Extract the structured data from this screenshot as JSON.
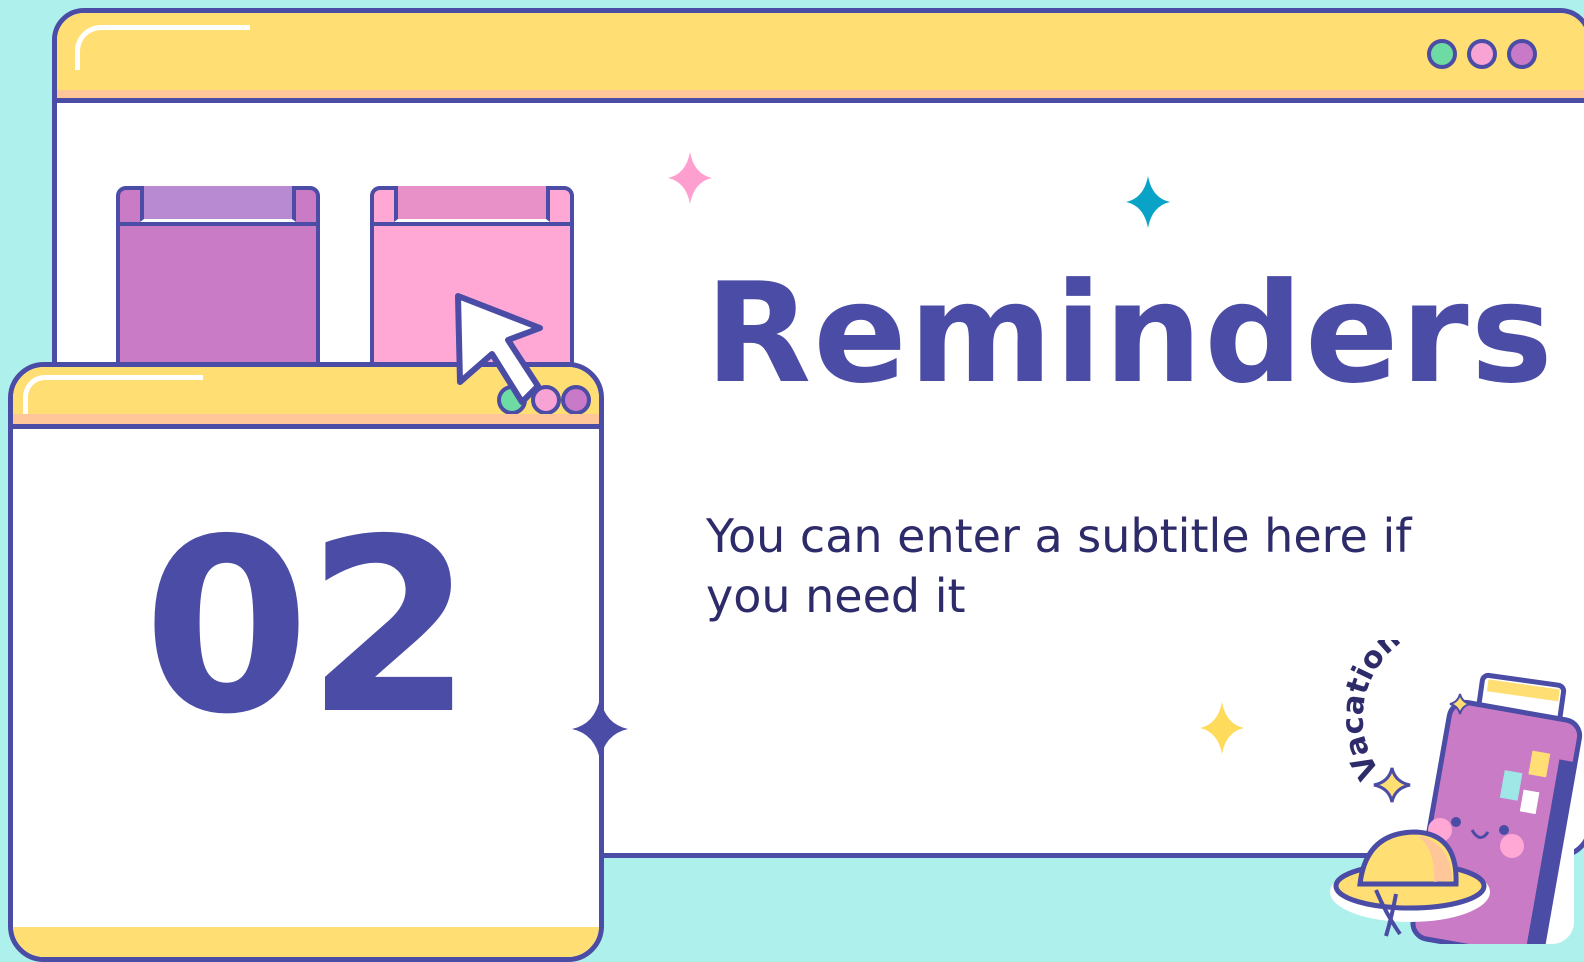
{
  "slide": {
    "title": "Reminders",
    "subtitle": "You can enter a subtitle here if you need it",
    "section_number": "02",
    "sticker_text": "Vacations!"
  },
  "window_controls": [
    {
      "name": "dot-green",
      "color": "#6fdba4"
    },
    {
      "name": "dot-pink",
      "color": "#f7a3d3"
    },
    {
      "name": "dot-purple",
      "color": "#c879c8"
    }
  ],
  "colors": {
    "background": "#aef0eb",
    "outline": "#4a4ca5",
    "titlebar": "#ffde73",
    "folder_purple": "#c97bc5",
    "folder_pink": "#ffa8d5",
    "sparkle_pink": "#ff9fcf",
    "sparkle_teal": "#0aa3c8",
    "sparkle_yellow": "#ffdb5c"
  },
  "icons": [
    "cursor-arrow-icon",
    "sparkle-icon",
    "suitcase-sticker-icon",
    "sun-hat-icon"
  ]
}
